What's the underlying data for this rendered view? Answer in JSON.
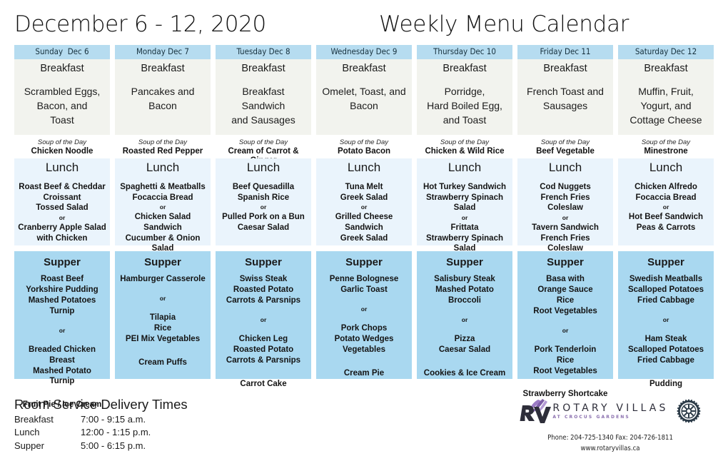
{
  "header": {
    "date_range": "December 6 - 12, 2020",
    "title": "Weekly Menu Calendar"
  },
  "labels": {
    "breakfast": "Breakfast",
    "lunch": "Lunch",
    "supper": "Supper",
    "soup_of_the_day": "Soup of the Day",
    "or": "or"
  },
  "colors": {
    "day_header_bg": "#b6dcf0",
    "breakfast_bg": "#f2f3ee",
    "lunch_bg": "#eaf4fc",
    "supper_bg": "#a9d8f0",
    "brand_purple": "#8a6fae",
    "brand_dark": "#2e2e3a"
  },
  "days": [
    {
      "header": "Sunday  Dec 6",
      "breakfast": "Scrambled Eggs,\nBacon, and\nToast",
      "soup": "Chicken Noodle",
      "lunch_option_1": "Roast Beef & Cheddar\nCroissant\nTossed Salad",
      "lunch_option_2": "Cranberry Apple Salad\nwith Chicken",
      "supper_option_1": "Roast Beef\nYorkshire Pudding\nMashed Potatoes\nTurnip",
      "supper_option_2": "Breaded Chicken Breast\nMashed Potato\nTurnip",
      "dessert": "Fruit Pie / Ice Cream"
    },
    {
      "header": "Monday Dec 7",
      "breakfast": "Pancakes and\nBacon",
      "soup": "Roasted Red Pepper",
      "lunch_option_1": "Spaghetti & Meatballs\nFocaccia Bread",
      "lunch_option_2": "Chicken Salad\nSandwich\nCucumber & Onion\nSalad",
      "supper_option_1": "Hamburger Casserole",
      "supper_option_2": "Tilapia\nRice\nPEI Mix Vegetables",
      "dessert": "Cream Puffs"
    },
    {
      "header": "Tuesday Dec 8",
      "breakfast": "Breakfast\nSandwich\nand Sausages",
      "soup": "Cream of Carrot & Ginger",
      "lunch_option_1": "Beef Quesadilla\nSpanish Rice",
      "lunch_option_2": "Pulled Pork on a Bun\nCaesar Salad",
      "supper_option_1": "Swiss Steak\nRoasted Potato\nCarrots & Parsnips",
      "supper_option_2": "Chicken Leg\nRoasted Potato\nCarrots & Parsnips",
      "dessert": "Carrot Cake"
    },
    {
      "header": "Wednesday Dec 9",
      "breakfast": "Omelet, Toast, and\nBacon",
      "soup": "Potato Bacon",
      "lunch_option_1": "Tuna Melt\nGreek Salad",
      "lunch_option_2": "Grilled Cheese\nSandwich\nGreek Salad",
      "supper_option_1": "Penne Bolognese\nGarlic Toast",
      "supper_option_2": "Pork Chops\nPotato Wedges\nVegetables",
      "dessert": "Cream Pie"
    },
    {
      "header": "Thursday Dec 10",
      "breakfast": "Porridge,\nHard Boiled Egg,\nand Toast",
      "soup": "Chicken & Wild Rice",
      "lunch_option_1": "Hot Turkey Sandwich\nStrawberry Spinach\nSalad",
      "lunch_option_2": "Frittata\nStrawberry Spinach\nSalad",
      "supper_option_1": "Salisbury Steak\nMashed Potato\nBroccoli",
      "supper_option_2": "Pizza\nCaesar Salad",
      "dessert": "Cookies & Ice Cream"
    },
    {
      "header": "Friday Dec 11",
      "breakfast": "French Toast and\nSausages",
      "soup": "Beef Vegetable",
      "lunch_option_1": "Cod Nuggets\nFrench Fries\nColeslaw",
      "lunch_option_2": "Tavern Sandwich\nFrench Fries\nColeslaw",
      "supper_option_1": "Basa with\nOrange Sauce\nRice\nRoot Vegetables",
      "supper_option_2": "Pork Tenderloin\nRice\nRoot Vegetables",
      "dessert": "Strawberry Shortcake"
    },
    {
      "header": "Saturday Dec 12",
      "breakfast": "Muffin, Fruit,\nYogurt, and\nCottage Cheese",
      "soup": "Minestrone",
      "lunch_option_1": "Chicken Alfredo\nFocaccia Bread",
      "lunch_option_2": "Hot Beef Sandwich\nPeas & Carrots",
      "supper_option_1": "Swedish Meatballs\nScalloped Potatoes\nFried Cabbage",
      "supper_option_2": "Ham Steak\nScalloped Potatoes\nFried Cabbage",
      "dessert": "Pudding"
    }
  ],
  "room_service": {
    "title": "Room Service Delivery Times",
    "rows": [
      {
        "meal": "Breakfast",
        "time": "7:00 - 9:15 a.m."
      },
      {
        "meal": "Lunch",
        "time": "12:00 - 1:15 p.m."
      },
      {
        "meal": "Supper",
        "time": "5:00 - 6:15 p.m."
      }
    ]
  },
  "brand": {
    "name": "ROTARY VILLAS",
    "tagline": "AT CROCUS GARDENS",
    "contact_line": "Phone: 204-725-1340  Fax: 204-726-1811",
    "website": "www.rotaryvillas.ca"
  }
}
